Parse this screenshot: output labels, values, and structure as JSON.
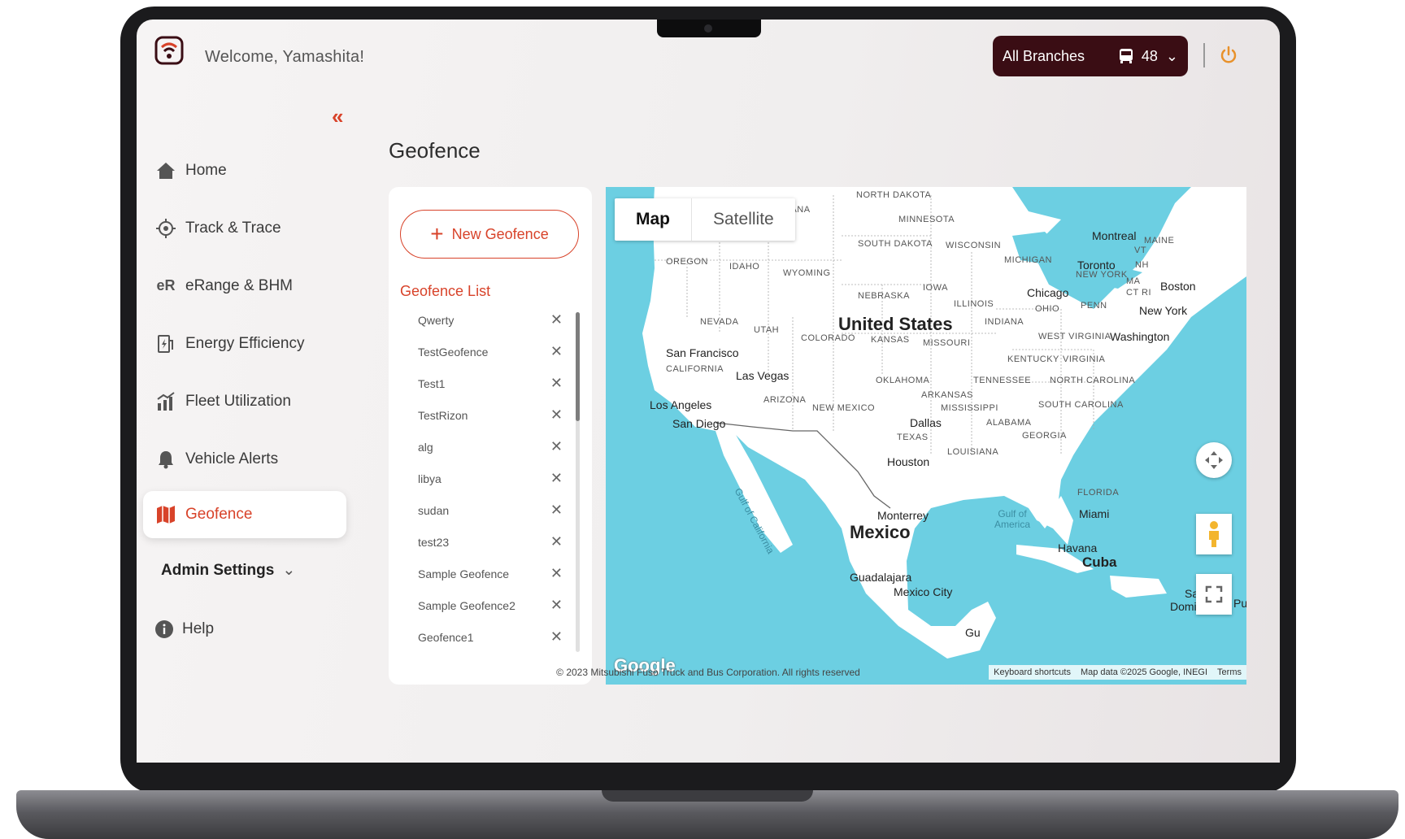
{
  "header": {
    "welcome": "Welcome, Yamashita!",
    "branch": "All Branches",
    "vehicle_count": "48"
  },
  "sidebar": {
    "items": [
      {
        "label": "Home",
        "icon": "home-icon"
      },
      {
        "label": "Track & Trace",
        "icon": "crosshair-icon"
      },
      {
        "label": "eRange & BHM",
        "icon": "erange-icon"
      },
      {
        "label": "Energy Efficiency",
        "icon": "energy-icon"
      },
      {
        "label": "Fleet Utilization",
        "icon": "chart-icon"
      },
      {
        "label": "Vehicle Alerts",
        "icon": "bell-icon"
      },
      {
        "label": "Geofence",
        "icon": "map-icon"
      }
    ],
    "admin_label": "Admin Settings",
    "help_label": "Help"
  },
  "main": {
    "title": "Geofence",
    "new_button": "New Geofence",
    "list_title": "Geofence List",
    "geofences": [
      "Qwerty",
      "TestGeofence",
      "Test1",
      "TestRizon",
      "alg",
      "libya",
      "sudan",
      "test23",
      "Sample Geofence",
      "Sample Geofence2",
      "Geofence1"
    ]
  },
  "map": {
    "tab_map": "Map",
    "tab_satellite": "Satellite",
    "google": "Google",
    "keyboard": "Keyboard shortcuts",
    "map_data": "Map data ©2025 Google, INEGI",
    "terms": "Terms",
    "countries": {
      "us": "United States",
      "mx": "Mexico",
      "cuba": "Cuba"
    },
    "water": {
      "gulf": "Gulf of America",
      "gulf_ca": "Gulf of California"
    },
    "cities": {
      "sf": "San Francisco",
      "lv": "Las Vegas",
      "la": "Los Angeles",
      "sd": "San Diego",
      "dallas": "Dallas",
      "houston": "Houston",
      "monterrey": "Monterrey",
      "guadalajara": "Guadalajara",
      "mexico_city": "Mexico City",
      "chicago": "Chicago",
      "toronto": "Toronto",
      "montreal": "Montreal",
      "boston": "Boston",
      "ny": "New York",
      "washington": "Washington",
      "miami": "Miami",
      "havana": "Havana",
      "santo": "Santo",
      "domingo": "Doming",
      "gua": "Gu",
      "pu": "Pu"
    },
    "states": {
      "north_dakota": "NORTH DAKOTA",
      "montana": "IONTANA",
      "minnesota": "MINNESOTA",
      "south_dakota": "SOUTH DAKOTA",
      "wisconsin": "WISCONSIN",
      "michigan": "MICHIGAN",
      "oregon": "OREGON",
      "idaho": "IDAHO",
      "wyoming": "WYOMING",
      "nebraska": "NEBRASKA",
      "iowa": "IOWA",
      "illinois": "ILLINOIS",
      "ohio": "OHIO",
      "penn": "PENN",
      "new_york": "NEW YORK",
      "maine": "MAINE",
      "vt": "VT",
      "nh": "NH",
      "ma": "MA",
      "ct_ri": "CT RI",
      "nevada": "NEVADA",
      "utah": "UTAH",
      "colorado": "COLORADO",
      "kansas": "KANSAS",
      "missouri": "MISSOURI",
      "indiana": "INDIANA",
      "west_virginia": "WEST VIRGINIA",
      "kentucky": "KENTUCKY",
      "virginia": "VIRGINIA",
      "california": "CALIFORNIA",
      "oklahoma": "OKLAHOMA",
      "tennessee": "TENNESSEE",
      "north_carolina": "NORTH CAROLINA",
      "arizona": "ARIZONA",
      "new_mexico": "NEW MEXICO",
      "arkansas": "ARKANSAS",
      "mississippi": "MISSISSIPPI",
      "south_carolina": "SOUTH CAROLINA",
      "alabama": "ALABAMA",
      "georgia": "GEORGIA",
      "texas": "TEXAS",
      "louisiana": "LOUISIANA",
      "florida": "FLORIDA"
    }
  },
  "footer": "© 2023 Mitsubishi Fuso Truck and Bus Corporation. All rights reserved",
  "colors": {
    "accent": "#d8432a",
    "brand_dark": "#3a0d14",
    "water": "#6ccfe2"
  }
}
